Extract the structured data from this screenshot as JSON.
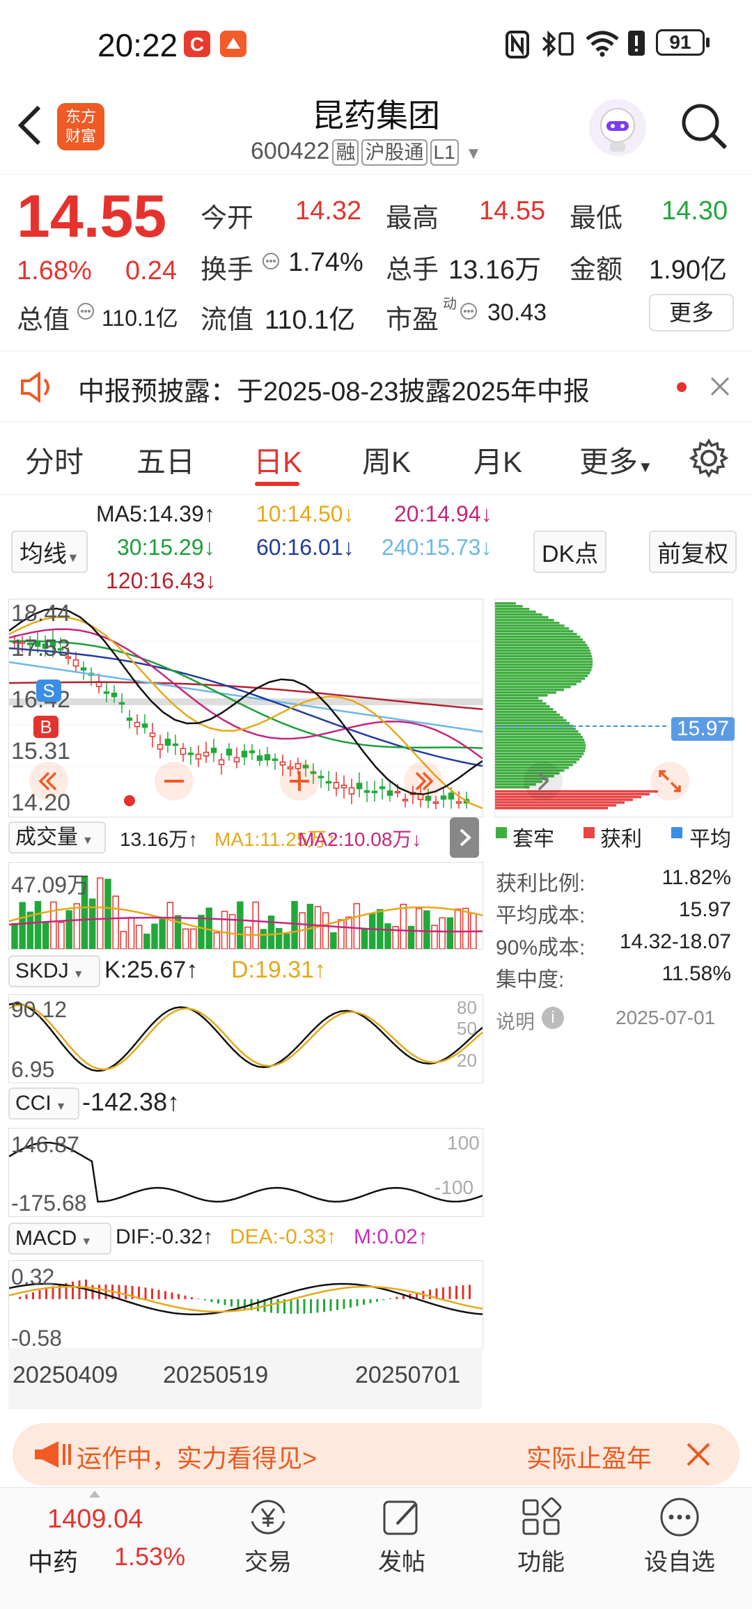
{
  "status_bar": {
    "time": "20:22",
    "battery": "91"
  },
  "header": {
    "title": "昆药集团",
    "code": "600422",
    "tags": [
      "融",
      "沪股通",
      "L1"
    ]
  },
  "quote": {
    "price": "14.55",
    "change_pct": "1.68%",
    "change": "0.24",
    "rows": [
      [
        {
          "label": "今开",
          "value": "14.32"
        },
        {
          "label": "最高",
          "value": "14.55"
        },
        {
          "label": "最低",
          "value": "14.30"
        }
      ],
      [
        {
          "label": "换手",
          "value": "1.74%"
        },
        {
          "label": "总手",
          "value": "13.16万"
        },
        {
          "label": "金额",
          "value": "1.90亿"
        }
      ]
    ],
    "mcap_label": "总值",
    "mcap_value": "110.1亿",
    "float_label": "流值",
    "float_value": "110.1亿",
    "pe_label": "市盈",
    "pe_sup": "动",
    "pe_value": "30.43",
    "more_button": "更多"
  },
  "notice": {
    "text": "中报预披露：于2025-08-23披露2025年中报"
  },
  "tabs": [
    "分时",
    "五日",
    "日K",
    "周K",
    "月K",
    "更多"
  ],
  "active_tab": "日K",
  "ma": {
    "ma5": "MA5:14.39↑",
    "ma10": "10:14.50↓",
    "ma20": "20:14.94↓",
    "ma30": "30:15.29↓",
    "ma60": "60:16.01↓",
    "ma240": "240:15.73↓",
    "ma120": "120:16.43↓",
    "selector": "均线",
    "dk_button": "DK点",
    "adjust_button": "前复权"
  },
  "kline": {
    "price_ticks": [
      "18.44",
      "17.53",
      "16.42",
      "15.31",
      "14.20"
    ],
    "badges": {
      "s": "S",
      "b": "B"
    }
  },
  "chip": {
    "avg_marker": "15.97",
    "legend": [
      "套牢",
      "获利",
      "平均"
    ],
    "stats": [
      {
        "label": "获利比例:",
        "value": "11.82%"
      },
      {
        "label": "平均成本:",
        "value": "15.97"
      },
      {
        "label": "90%成本:",
        "value": "14.32-18.07"
      },
      {
        "label": "集中度:",
        "value": "11.58%"
      }
    ],
    "note_label": "说明",
    "note_date": "2025-07-01"
  },
  "volume": {
    "selector": "成交量",
    "vol": "13.16万↑",
    "ma1": "MA1:11.25万↑",
    "ma2": "MA2:10.08万↓",
    "max_label": "47.09万"
  },
  "skdj": {
    "selector": "SKDJ",
    "k": "K:25.67↑",
    "d": "D:19.31↑",
    "hi": "90.12",
    "lo": "6.95",
    "levels": [
      "80",
      "50",
      "20"
    ]
  },
  "cci": {
    "selector": "CCI",
    "value": "-142.38↑",
    "hi": "146.87",
    "lo": "-175.68",
    "levels": [
      "100",
      "-100"
    ]
  },
  "macd": {
    "selector": "MACD",
    "dif": "DIF:-0.32↑",
    "dea": "DEA:-0.33↑",
    "m": "M:0.02↑",
    "hi": "0.32",
    "lo": "-0.58"
  },
  "dates": [
    "20250409",
    "20250519",
    "20250701"
  ],
  "ad": {
    "left_text": "运作中，实力看得见>",
    "right_text": "实际止盈年"
  },
  "bottom_nav": {
    "index_value": "1409.04",
    "index_name": "中药",
    "index_change": "1.53%",
    "items": [
      "交易",
      "发帖",
      "功能",
      "设自选"
    ]
  },
  "colors": {
    "up": "#e5322d",
    "down": "#22a83a",
    "accent": "#f05a24"
  }
}
